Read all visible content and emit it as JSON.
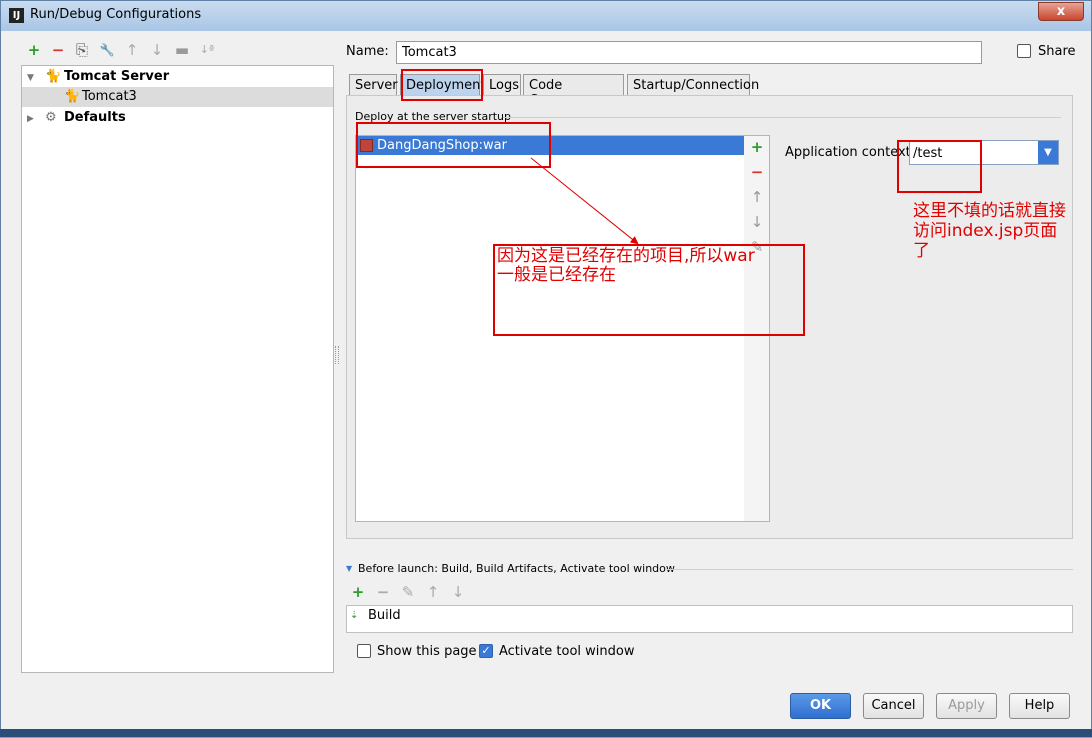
{
  "window": {
    "title": "Run/Debug Configurations",
    "app_icon": "IJ",
    "close_glyph": "x"
  },
  "toolbar": {
    "add": "+",
    "remove": "−",
    "copy": "⎘",
    "edit": "🔧",
    "up": "↑",
    "down": "↓",
    "folder": "▬",
    "sort": "↓ª"
  },
  "tree": {
    "group1": {
      "label": "Tomcat Server",
      "expand_glyph": "▼",
      "icon": "tomcat-icon"
    },
    "child1": {
      "label": "Tomcat3",
      "icon": "tomcat-icon"
    },
    "group2": {
      "label": "Defaults",
      "expand_glyph": "▶",
      "icon": "wrench-icon"
    }
  },
  "name_field": {
    "label": "Name:",
    "value": "Tomcat3"
  },
  "share": {
    "label": "Share",
    "checked": false
  },
  "tabs": [
    "Server",
    "Deployment",
    "Logs",
    "Code Coverage",
    "Startup/Connection"
  ],
  "active_tab": "Deployment",
  "deploy": {
    "section_label": "Deploy at the server startup",
    "items": [
      "DangDangShop:war"
    ],
    "side_buttons": {
      "add": "+",
      "remove": "−",
      "up": "↑",
      "down": "↓",
      "edit": "✎"
    }
  },
  "app_context": {
    "label": "Application context",
    "value": "/test",
    "dropdown_glyph": "▼"
  },
  "annotations": {
    "note1_line1": "因为这是已经存在的项目,所以war",
    "note1_line2": "一般是已经存在",
    "note2_line1": "这里不填的话就直接",
    "note2_line2": "访问index.jsp页面",
    "note2_line3": "了"
  },
  "before_launch": {
    "label": "Before launch: Build, Build Artifacts, Activate tool window",
    "toggle_glyph": "▼",
    "toolbar": {
      "add": "+",
      "remove": "−",
      "edit": "✎",
      "up": "↑",
      "down": "↓"
    },
    "items": [
      "Build"
    ]
  },
  "options": {
    "show_page": {
      "label": "Show this page",
      "checked": false
    },
    "activate_tool": {
      "label": "Activate tool window",
      "checked": true,
      "glyph": "✓"
    }
  },
  "buttons": {
    "ok": "OK",
    "cancel": "Cancel",
    "apply": "Apply",
    "help": "Help"
  },
  "colors": {
    "accent": "#3a7ad6",
    "add_green": "#2a9d2a",
    "remove_red": "#d9342b",
    "annotation_red": "#e00000"
  }
}
